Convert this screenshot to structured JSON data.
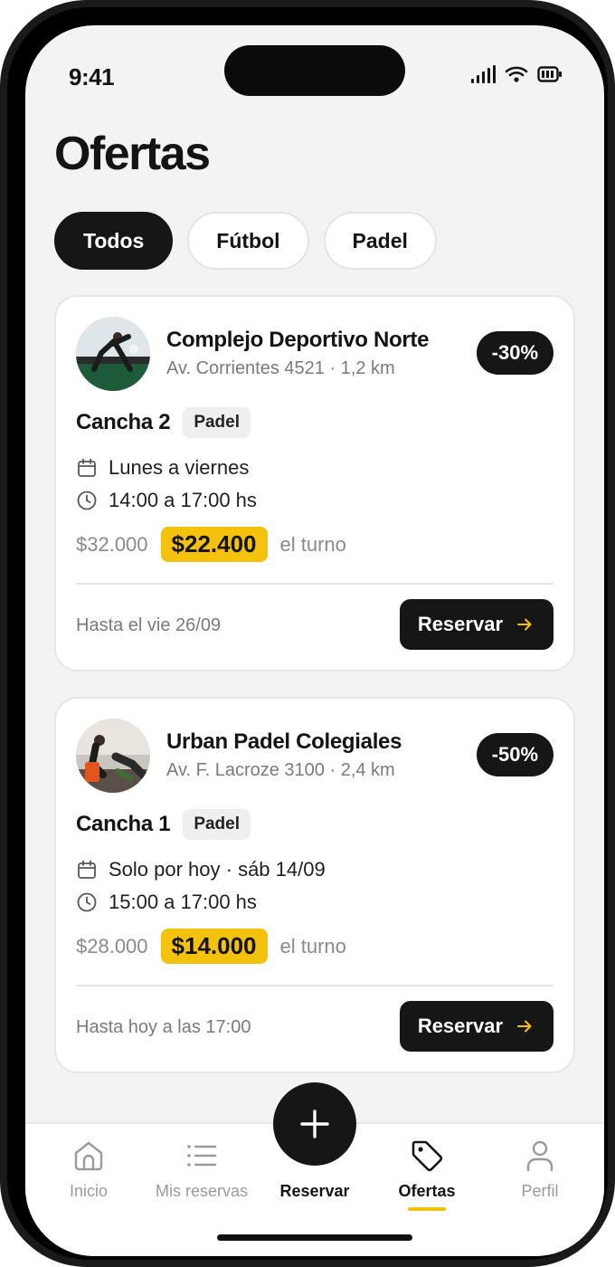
{
  "status_bar": {
    "time": "9:41"
  },
  "page": {
    "title": "Ofertas"
  },
  "filters": [
    {
      "label": "Todos",
      "active": true
    },
    {
      "label": "Fútbol",
      "active": false
    },
    {
      "label": "Padel",
      "active": false
    }
  ],
  "offers": [
    {
      "venue": "Complejo Deportivo Norte",
      "address": "Av. Corrientes 4521 · 1,2 km",
      "discount": "-30%",
      "court": "Cancha 2",
      "sport": "Padel",
      "days": "Lunes a viernes",
      "hours": "14:00 a 17:00 hs",
      "old_price": "$32.000",
      "new_price": "$22.400",
      "unit": "el turno",
      "deadline": "Hasta el vie 26/09",
      "cta": "Reservar"
    },
    {
      "venue": "Urban Padel Colegiales",
      "address": "Av. F. Lacroze 3100 · 2,4 km",
      "discount": "-50%",
      "court": "Cancha 1",
      "sport": "Padel",
      "days": "Solo por hoy · sáb 14/09",
      "hours": "15:00 a 17:00 hs",
      "old_price": "$28.000",
      "new_price": "$14.000",
      "unit": "el turno",
      "deadline": "Hasta hoy a las 17:00",
      "cta": "Reservar"
    }
  ],
  "tabbar": {
    "items": [
      {
        "label": "Inicio",
        "icon": "home-icon",
        "active": false
      },
      {
        "label": "Mis reservas",
        "icon": "list-icon",
        "active": false
      },
      {
        "label": "Reservar",
        "icon": "plus-icon",
        "active": false
      },
      {
        "label": "Ofertas",
        "icon": "tag-icon",
        "active": true
      },
      {
        "label": "Perfil",
        "icon": "user-icon",
        "active": false
      }
    ]
  },
  "colors": {
    "accent": "#f4c20d",
    "dark": "#161616",
    "background": "#f3f3f3"
  }
}
